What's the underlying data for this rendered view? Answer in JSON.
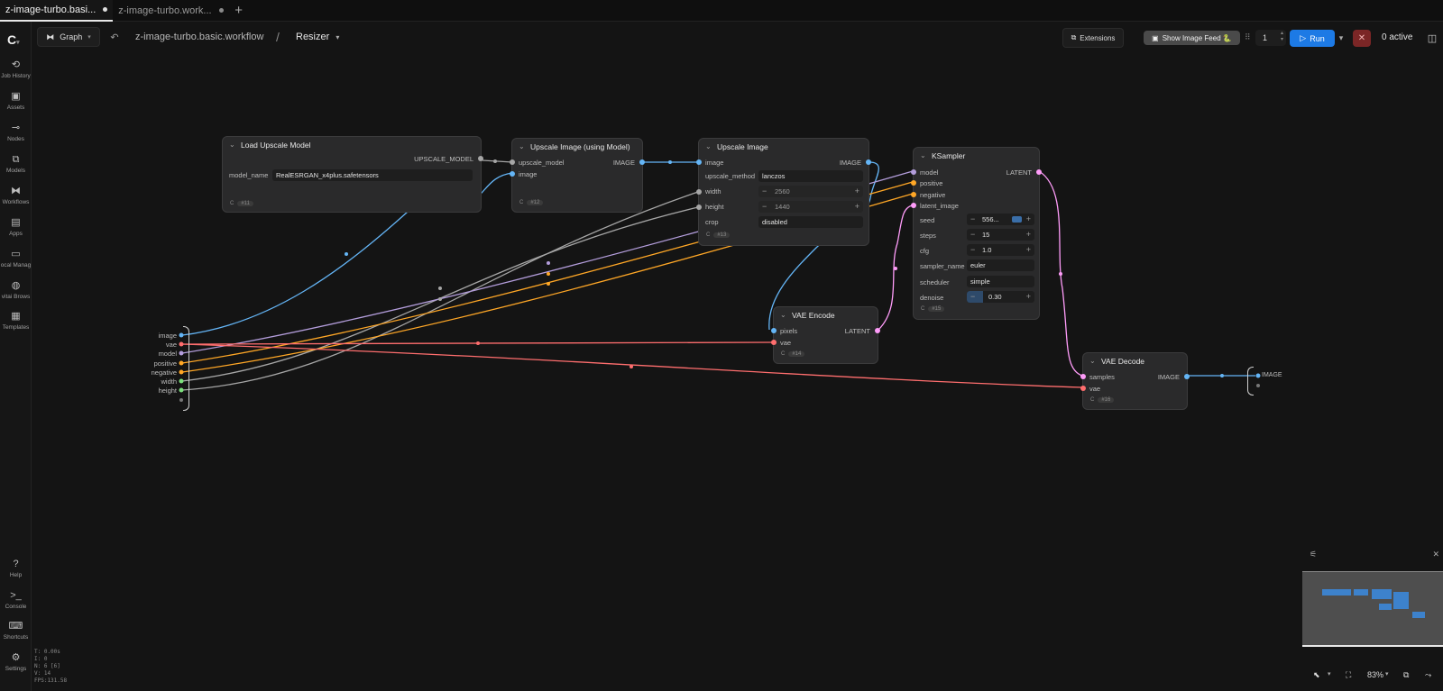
{
  "tabs": [
    {
      "label": "z-image-turbo.basi...",
      "active": true
    },
    {
      "label": "z-image-turbo.work...",
      "active": false
    }
  ],
  "sidebar": {
    "items": [
      {
        "label": "Job History",
        "icon": "history-icon"
      },
      {
        "label": "Assets",
        "icon": "image-icon"
      },
      {
        "label": "Nodes",
        "icon": "node-icon"
      },
      {
        "label": "Models",
        "icon": "models-icon"
      },
      {
        "label": "Workflows",
        "icon": "workflow-icon"
      },
      {
        "label": "Apps",
        "icon": "apps-icon"
      },
      {
        "label": "ocal Manag",
        "icon": "folder-icon"
      },
      {
        "label": "vitai Brows",
        "icon": "globe-icon"
      },
      {
        "label": "Templates",
        "icon": "templates-icon"
      }
    ],
    "bottom": [
      {
        "label": "Help",
        "icon": "help-icon"
      },
      {
        "label": "Console",
        "icon": "console-icon"
      },
      {
        "label": "Shortcuts",
        "icon": "keyboard-icon"
      },
      {
        "label": "Settings",
        "icon": "gear-icon"
      }
    ]
  },
  "stats": [
    "T: 0.00s",
    "I: 0",
    "N: 6 [6]",
    "V: 14",
    "FPS:131.58"
  ],
  "toolbar": {
    "graph_label": "Graph",
    "workflow_name": "z-image-turbo.basic.workflow",
    "separator": "/",
    "subgraph_name": "Resizer",
    "extensions_label": "Extensions",
    "image_feed_label": "Show Image Feed 🐍",
    "queue_count": "1",
    "run_label": "Run",
    "active_label": "0 active"
  },
  "nodes": {
    "load_upscale": {
      "title": "Load Upscale Model",
      "output": "UPSCALE_MODEL",
      "widget_label": "model_name",
      "widget_value": "RealESRGAN_x4plus.safetensors",
      "id": "#11"
    },
    "upscale_using_model": {
      "title": "Upscale Image (using Model)",
      "inputs": [
        "upscale_model",
        "image"
      ],
      "output": "IMAGE",
      "id": "#12"
    },
    "upscale_image": {
      "title": "Upscale Image",
      "input": "image",
      "output": "IMAGE",
      "method_label": "upscale_method",
      "method_value": "lanczos",
      "width_label": "width",
      "width_value": "2560",
      "height_label": "height",
      "height_value": "1440",
      "crop_label": "crop",
      "crop_value": "disabled",
      "id": "#13"
    },
    "ksampler": {
      "title": "KSampler",
      "inputs": [
        "model",
        "positive",
        "negative",
        "latent_image"
      ],
      "output": "LATENT",
      "seed_label": "seed",
      "seed_value": "556...",
      "steps_label": "steps",
      "steps_value": "15",
      "cfg_label": "cfg",
      "cfg_value": "1.0",
      "sampler_label": "sampler_name",
      "sampler_value": "euler",
      "scheduler_label": "scheduler",
      "scheduler_value": "simple",
      "denoise_label": "denoise",
      "denoise_value": "0.30",
      "id": "#15"
    },
    "vae_encode": {
      "title": "VAE Encode",
      "inputs": [
        "pixels",
        "vae"
      ],
      "output": "LATENT",
      "id": "#14"
    },
    "vae_decode": {
      "title": "VAE Decode",
      "inputs": [
        "samples",
        "vae"
      ],
      "output": "IMAGE",
      "id": "#16"
    }
  },
  "subgraph_inputs": [
    "image",
    "vae",
    "model",
    "positive",
    "negative",
    "width",
    "height"
  ],
  "subgraph_output": "IMAGE",
  "colors": {
    "image": "#64b5f6",
    "vae": "#ff6e6e",
    "model": "#b39ddb",
    "conditioning": "#ffa726",
    "int": "#a6a6a6",
    "latent": "#ff9cf9",
    "upscale_model": "#a6a6a6",
    "run": "#1d7ae5"
  },
  "zoom": "83%"
}
